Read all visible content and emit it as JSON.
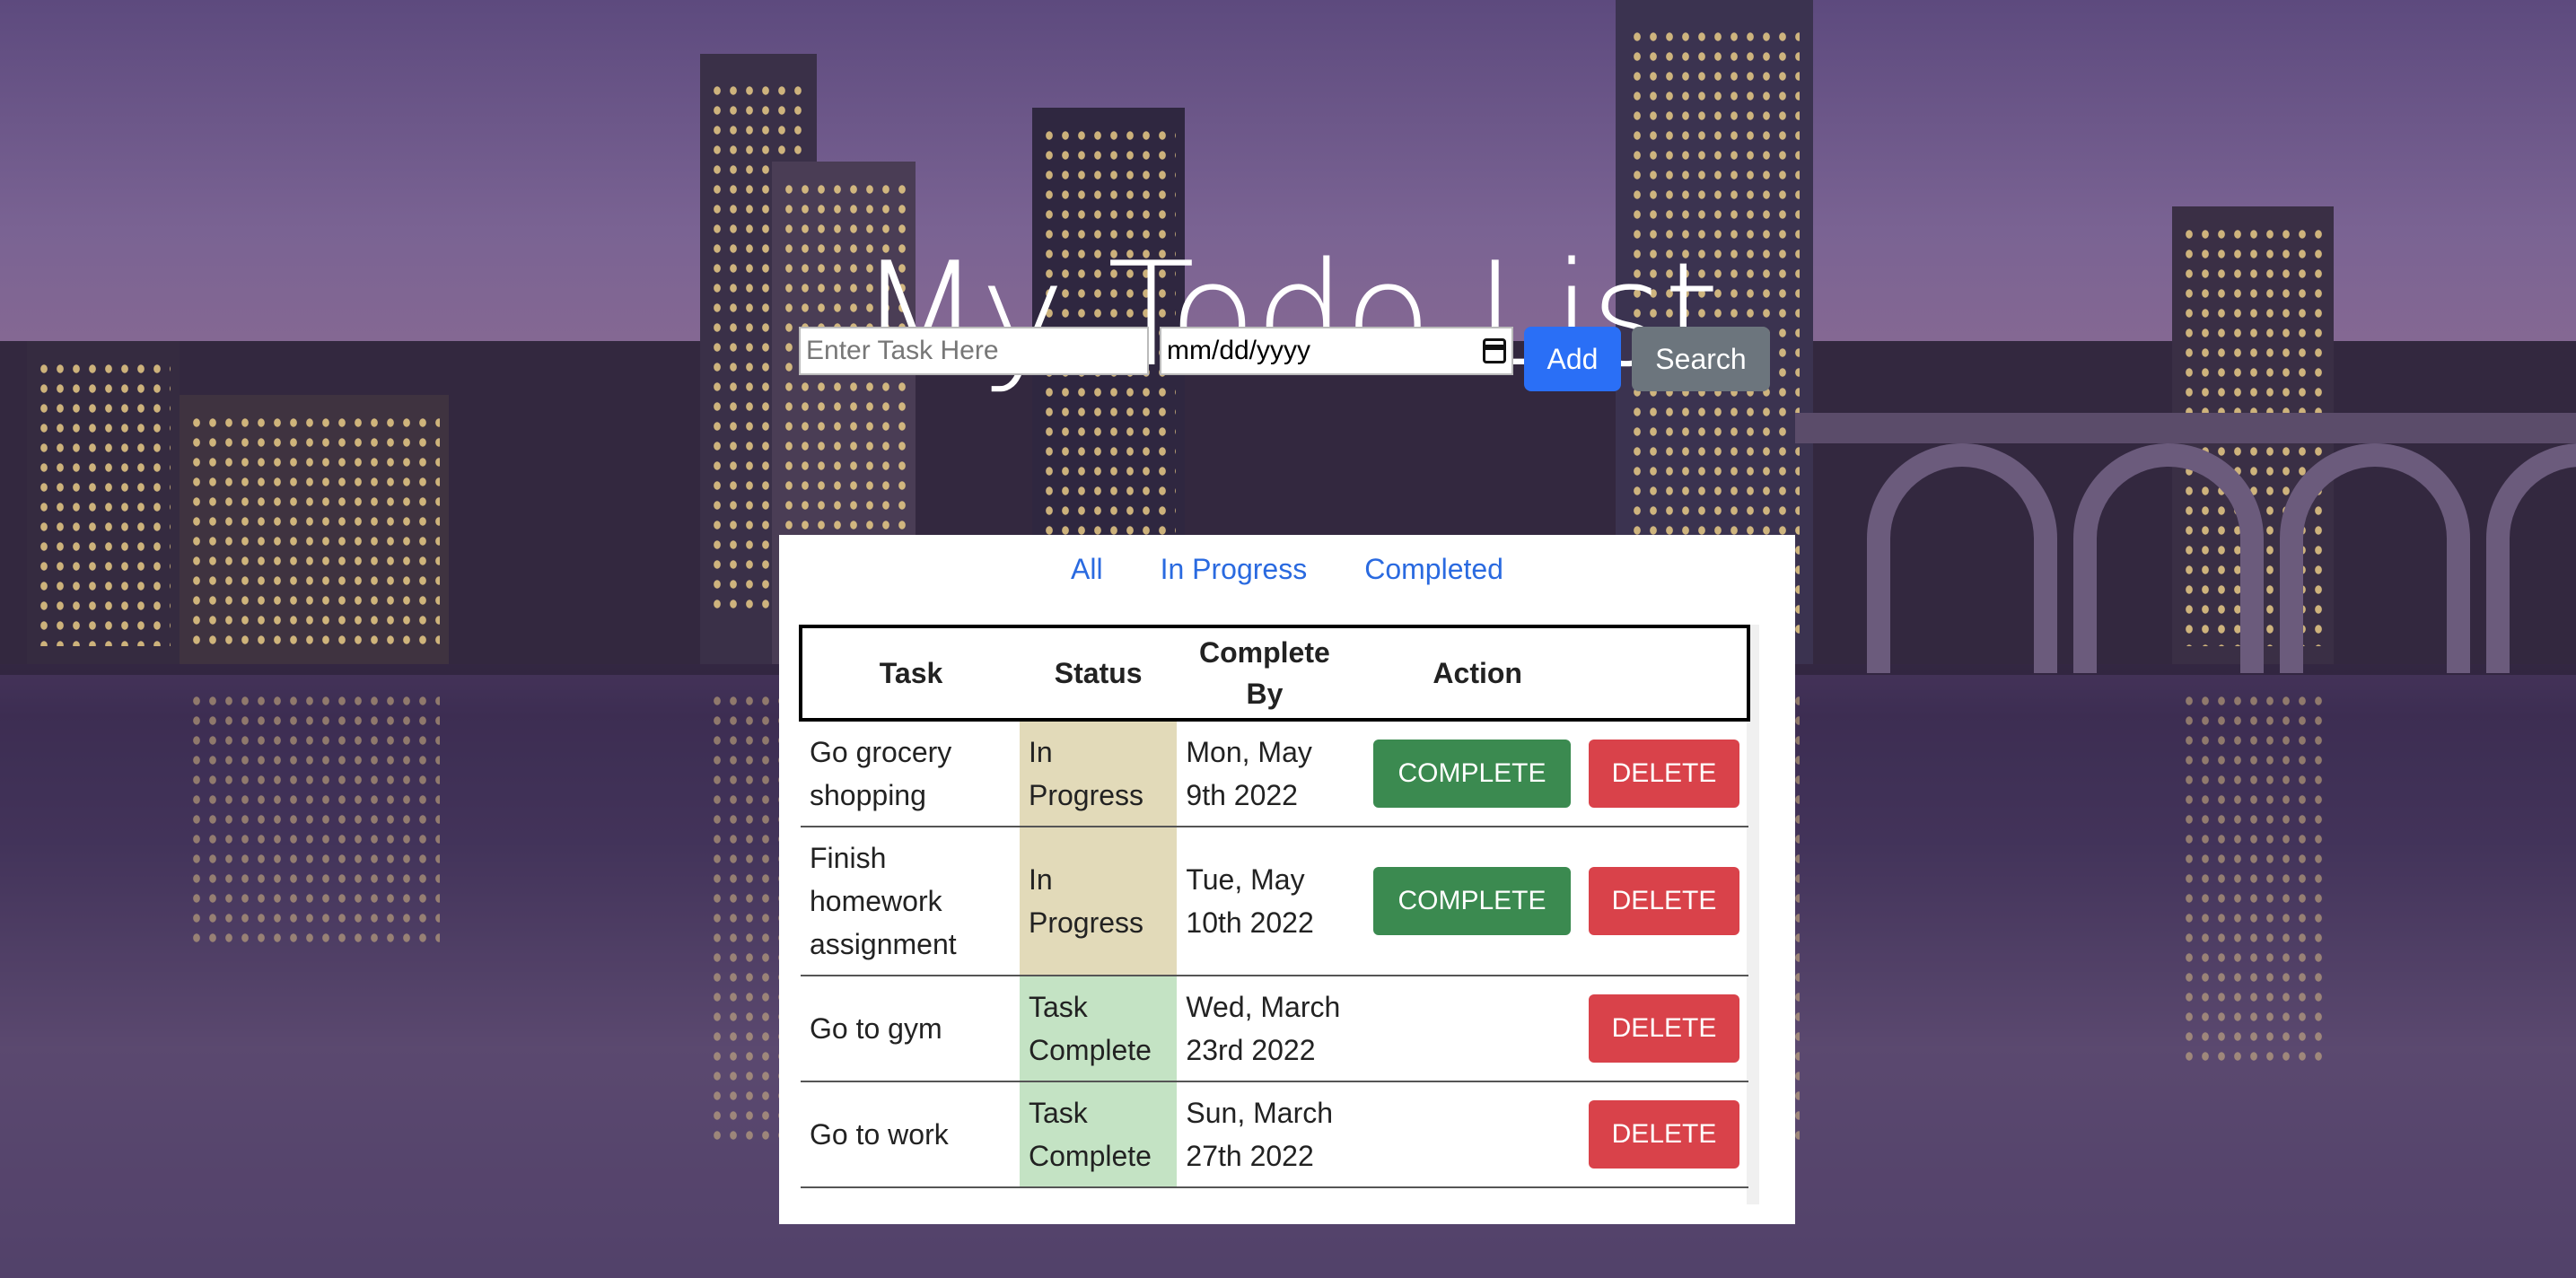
{
  "header": {
    "title": "My Todo List"
  },
  "form": {
    "task_placeholder": "Enter Task Here",
    "date_placeholder": "mm/dd/yyyy",
    "add_label": "Add",
    "search_label": "Search"
  },
  "filters": [
    "All",
    "In Progress",
    "Completed"
  ],
  "table": {
    "headers": {
      "task": "Task",
      "status": "Status",
      "complete_by": "Complete By",
      "action": "Action"
    },
    "rows": [
      {
        "task": "Go grocery shopping",
        "status": "In Progress",
        "complete_by": "Mon, May 9th 2022",
        "complete_label": "COMPLETE",
        "delete_label": "DELETE"
      },
      {
        "task": "Finish homework assignment",
        "status": "In Progress",
        "complete_by": "Tue, May 10th 2022",
        "complete_label": "COMPLETE",
        "delete_label": "DELETE"
      },
      {
        "task": "Go to gym",
        "status": "Task Complete",
        "complete_by": "Wed, March 23rd 2022",
        "complete_label": "",
        "delete_label": "DELETE"
      },
      {
        "task": "Go to work",
        "status": "Task Complete",
        "complete_by": "Sun, March 27th 2022",
        "complete_label": "",
        "delete_label": "DELETE"
      }
    ]
  },
  "colors": {
    "add_button": "#2a6ff6",
    "search_button": "#6c757d",
    "complete_button": "#3b8a50",
    "delete_button": "#d9424a",
    "status_in_progress": "#e2dab9",
    "status_complete": "#c4e3c4",
    "filter_link": "#2a6ae0"
  }
}
